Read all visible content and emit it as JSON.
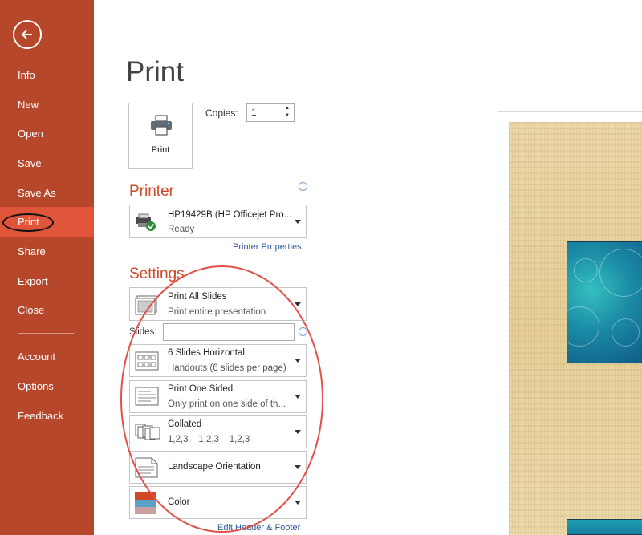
{
  "sidebar": {
    "items": [
      {
        "label": "Info"
      },
      {
        "label": "New"
      },
      {
        "label": "Open"
      },
      {
        "label": "Save"
      },
      {
        "label": "Save As"
      },
      {
        "label": "Print"
      },
      {
        "label": "Share"
      },
      {
        "label": "Export"
      },
      {
        "label": "Close"
      },
      {
        "label": "Account"
      },
      {
        "label": "Options"
      },
      {
        "label": "Feedback"
      }
    ],
    "active": "Print",
    "bg_color": "#b7472a",
    "active_color": "#e0553a"
  },
  "page": {
    "title": "Print"
  },
  "print_action": {
    "label": "Print",
    "icon": "printer-icon"
  },
  "copies": {
    "label": "Copies:",
    "value": "1"
  },
  "printer": {
    "heading": "Printer",
    "name": "HP19429B (HP Officejet Pro...",
    "status": "Ready",
    "properties_link": "Printer Properties"
  },
  "settings": {
    "heading": "Settings",
    "print_range": {
      "title": "Print All Slides",
      "sub": "Print entire presentation"
    },
    "slides_label": "Slides:",
    "slides_value": "",
    "layout": {
      "title": "6 Slides Horizontal",
      "sub": "Handouts (6 slides per page)"
    },
    "sides": {
      "title": "Print One Sided",
      "sub": "Only print on one side of th..."
    },
    "collation": {
      "title": "Collated",
      "sub": "1,2,3    1,2,3    1,2,3"
    },
    "orientation": {
      "title": "Landscape Orientation"
    },
    "color": {
      "title": "Color"
    },
    "footer_link": "Edit Header & Footer"
  },
  "accent_color": "#d24726",
  "annotation_color": "#e2504a"
}
